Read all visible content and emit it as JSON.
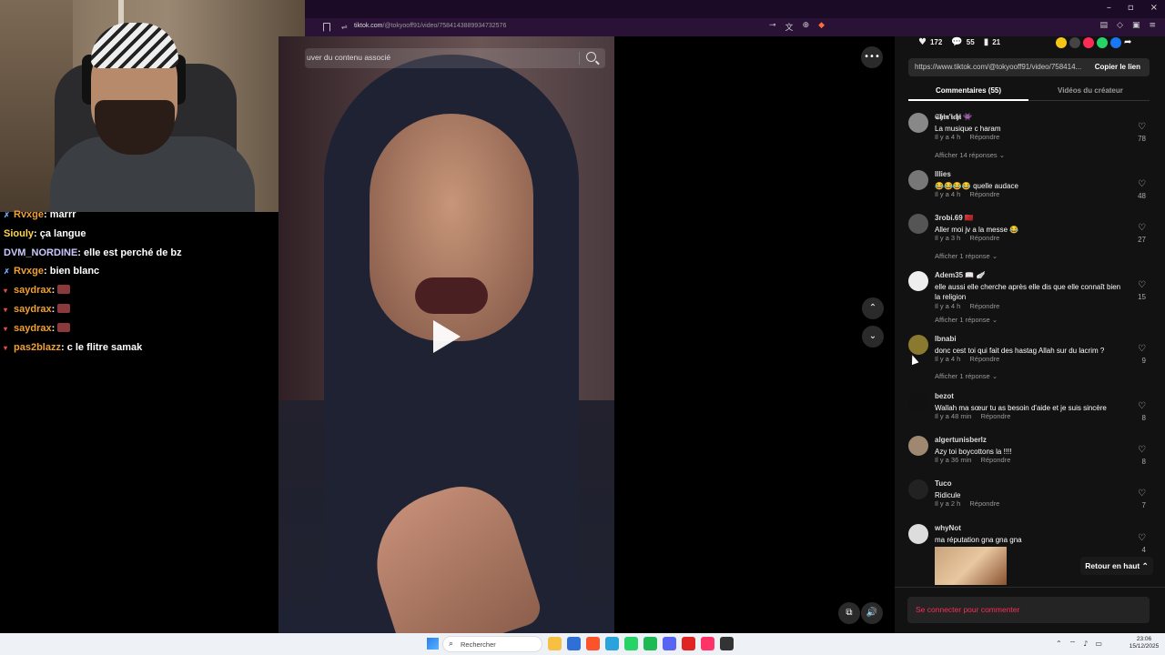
{
  "browser": {
    "url_host": "tiktok.com",
    "url_path": "/@tokyooff91/video/7584143889934732576",
    "window_controls": [
      "–",
      "▫",
      "×"
    ]
  },
  "chat": {
    "messages": [
      {
        "user": "Rvxge",
        "text": "marrr",
        "color": "#f0a030",
        "badge": "🗡"
      },
      {
        "user": "Siouly",
        "text": "ça langue",
        "color": "#ffd54a",
        "badge": ""
      },
      {
        "user": "DVM_NORDINE",
        "text": "elle est perché de bz",
        "color": "#c9c9ff",
        "badge": ""
      },
      {
        "user": "Rvxge",
        "text": "bien blanc",
        "color": "#f0a030",
        "badge": "🗡"
      },
      {
        "user": "saydrax",
        "text": "",
        "color": "#f0a030",
        "badge": "T",
        "emote": true
      },
      {
        "user": "saydrax",
        "text": "",
        "color": "#f0a030",
        "badge": "T",
        "emote": true
      },
      {
        "user": "saydrax",
        "text": "",
        "color": "#f0a030",
        "badge": "T",
        "emote": true
      },
      {
        "user": "pas2blazz",
        "text": "c le flitre samak",
        "color": "#f0a030",
        "badge": "T"
      }
    ]
  },
  "video": {
    "search_placeholder": "uver du contenu associé"
  },
  "panel": {
    "likes": "172",
    "comments_count": "55",
    "saves": "21",
    "link": "https://www.tiktok.com/@tokyooff91/video/758414...",
    "copy_label": "Copier le lien",
    "tab_comments": "Commentaires (55)",
    "tab_creator": "Vidéos du créateur",
    "reply_label": "Répondre",
    "comments": [
      {
        "name": "𝕾𝖍𝖎𝖓'𝖎𝖈𝖍𝖎 👾",
        "text": "La musique c haram",
        "time": "Il y a 4 h",
        "likes": "78",
        "replies": "Afficher 14 réponses ⌄",
        "avatar": "#888"
      },
      {
        "name": "lllies",
        "text": "😂😂😂😂 quelle audace",
        "time": "Il y a 4 h",
        "likes": "48",
        "replies": "",
        "avatar": "#777"
      },
      {
        "name": "3robi.69 🇲🇦",
        "text": "Aller moi jv a la messe 😂",
        "time": "Il y a 3 h",
        "likes": "27",
        "replies": "Afficher 1 réponse ⌄",
        "avatar": "#555"
      },
      {
        "name": "Adem35 📖 🪽",
        "text": "elle aussi elle cherche après elle dis que elle connaît bien la religion",
        "time": "Il y a 4 h",
        "likes": "15",
        "replies": "Afficher 1 réponse ⌄",
        "avatar": "#eee"
      },
      {
        "name": "lbnabi",
        "text": "donc cest toi qui fait des hastag Allah sur du lacrim ?",
        "time": "Il y a 4 h",
        "likes": "9",
        "replies": "Afficher 1 réponse ⌄",
        "avatar": "#8a7a30"
      },
      {
        "name": "bezot",
        "text": "Wallah ma sœur tu as besoin d'aide et je suis sincère",
        "time": "Il y a 48 min",
        "likes": "8",
        "replies": "",
        "avatar": "#111"
      },
      {
        "name": "algertunisberlz",
        "text": "Azy toi boycottons la !!!!",
        "time": "Il y a 36 min",
        "likes": "8",
        "replies": "",
        "avatar": "#a08870"
      },
      {
        "name": "Tuco",
        "text": "Ridicule",
        "time": "Il y a 2 h",
        "likes": "7",
        "replies": "",
        "avatar": "#222"
      },
      {
        "name": "whyNot",
        "text": "ma réputation gna gna gna",
        "time": "",
        "likes": "4",
        "replies": "",
        "avatar": "#ddd"
      }
    ],
    "back_to_top": "Retour en haut ⌃",
    "login_prompt": "Se connecter pour commenter"
  },
  "taskbar": {
    "search_placeholder": "Rechercher",
    "time": "23:06",
    "date": "15/12/2025"
  }
}
